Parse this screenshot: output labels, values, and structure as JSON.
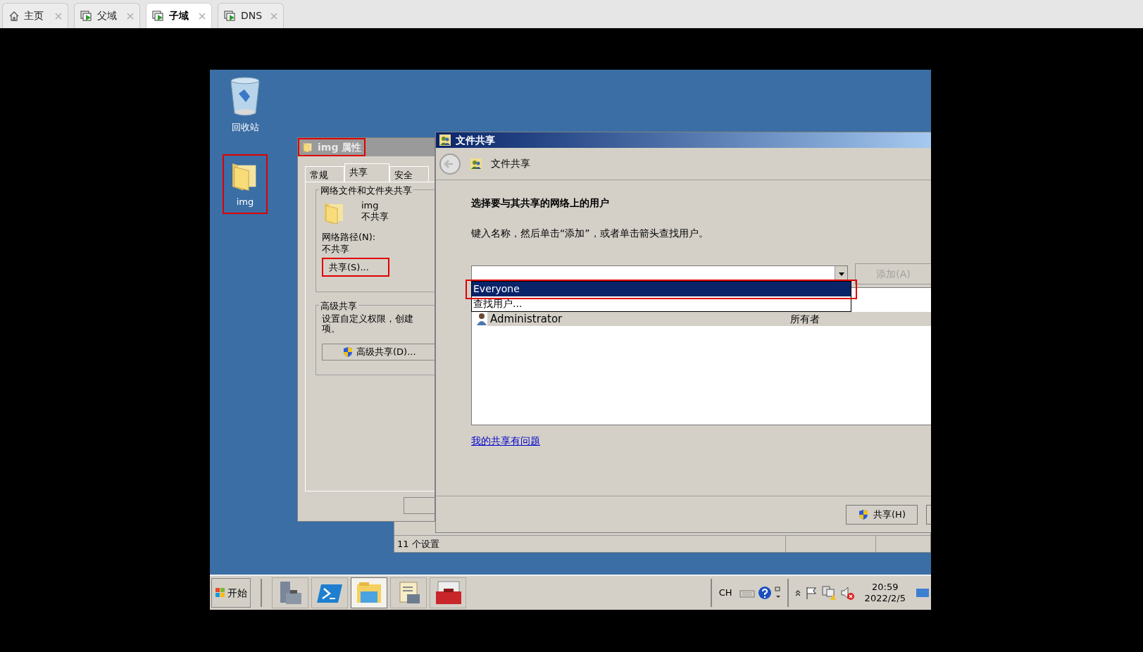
{
  "host_tabs": [
    {
      "label": "主页",
      "kind": "home",
      "selected": false
    },
    {
      "label": "父域",
      "kind": "vm",
      "selected": false
    },
    {
      "label": "子域",
      "kind": "vm",
      "selected": true
    },
    {
      "label": "DNS",
      "kind": "vm",
      "selected": false
    }
  ],
  "desktop_icons": [
    {
      "label": "回收站",
      "kind": "recycle_bin",
      "highlighted": false
    },
    {
      "label": "img",
      "kind": "folder",
      "highlighted": true
    }
  ],
  "properties_dialog": {
    "title": "img 属性",
    "tabs": [
      {
        "label": "常规",
        "selected": false
      },
      {
        "label": "共享",
        "selected": true
      },
      {
        "label": "安全",
        "selected": false
      }
    ],
    "network_group": {
      "legend": "网络文件和文件夹共享",
      "item_name": "img",
      "item_status": "不共享",
      "path_label": "网络路径(N):",
      "path_value": "不共享",
      "button": "共享(S)..."
    },
    "advanced_group": {
      "legend": "高级共享",
      "description_lines": [
        "设置自定义权限，创建",
        "项。"
      ],
      "button": "高级共享(D)..."
    }
  },
  "file_sharing_dialog": {
    "title": "文件共享",
    "header": "文件共享",
    "heading": "选择要与其共享的网络上的用户",
    "instruction": "键入名称，然后单击“添加”，或者单击箭头查找用户。",
    "add_button": {
      "label": "添加(A)",
      "disabled": true
    },
    "dropdown_options": [
      {
        "label": "Everyone",
        "selected": true
      },
      {
        "label": "查找用户...",
        "selected": false
      }
    ],
    "users": [
      {
        "name": "Administrator",
        "permission": "所有者"
      }
    ],
    "help_link": "我的共享有问题",
    "share_button": "共享(H)"
  },
  "background_window": {
    "status": "11 个设置"
  },
  "taskbar": {
    "start": "开始",
    "apps": [
      {
        "kind": "server",
        "active": false
      },
      {
        "kind": "powershell",
        "active": false
      },
      {
        "kind": "explorer",
        "active": true
      },
      {
        "kind": "scroll",
        "active": false
      },
      {
        "kind": "toolbox",
        "active": false
      }
    ],
    "language": "CH",
    "time": "20:59",
    "date": "2022/2/5"
  }
}
